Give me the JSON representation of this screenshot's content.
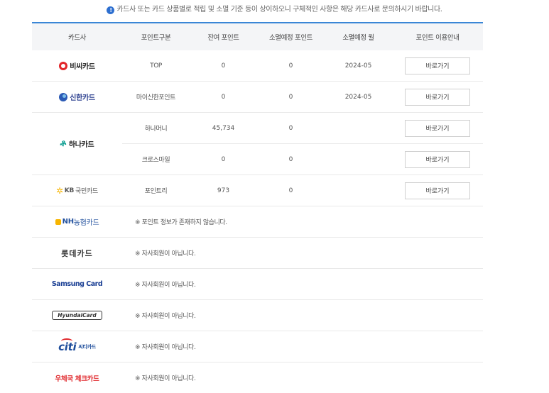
{
  "notice": {
    "icon": "info-icon",
    "text": "카드사 또는 카드 상품별로 적립 및 소멸 기준 등이 상이하오니 구체적인 사항은 해당 카드사로 문의하시기 바랍니다."
  },
  "headers": [
    "카드사",
    "포인트구분",
    "잔여 포인트",
    "소멸예정 포인트",
    "소멸예정 월",
    "포인트 이용안내"
  ],
  "button_label": "바로가기",
  "rows": [
    {
      "card": "비씨카드",
      "type": "TOP",
      "balance": "0",
      "expiring": "0",
      "month": "2024-05"
    },
    {
      "card": "신한카드",
      "type": "마이신한포인트",
      "balance": "0",
      "expiring": "0",
      "month": "2024-05"
    },
    {
      "card": "하나카드",
      "points": [
        {
          "type": "하나머니",
          "balance": "45,734",
          "expiring": "0",
          "month": ""
        },
        {
          "type": "크로스마일",
          "balance": "0",
          "expiring": "0",
          "month": ""
        }
      ]
    },
    {
      "card_mark": "KB",
      "card": "국민카드",
      "type": "포인트리",
      "balance": "973",
      "expiring": "0",
      "month": ""
    },
    {
      "card_mark": "NH",
      "card": "농협카드",
      "message": "※ 포인트 정보가 존재하지 않습니다."
    },
    {
      "card": "롯데카드",
      "message": "※ 자사회원이 아닙니다."
    },
    {
      "card": "Samsung Card",
      "message": "※ 자사회원이 아닙니다."
    },
    {
      "card": "HyundaiCard",
      "message": "※ 자사회원이 아닙니다."
    },
    {
      "card_mark": "citi",
      "card": "씨티카드",
      "message": "※ 자사회원이 아닙니다."
    },
    {
      "card": "우체국 체크카드",
      "message": "※ 자사회원이 아닙니다."
    }
  ],
  "colors": {
    "accent_border": "#3a86d6",
    "bc": "#e2262a",
    "shinhan": "#2b5ab5",
    "hana": "#079c8f",
    "kb": "#f6b400",
    "nh": "#1f4e9c",
    "samsung": "#1a3f94",
    "post": "#e0262a"
  }
}
